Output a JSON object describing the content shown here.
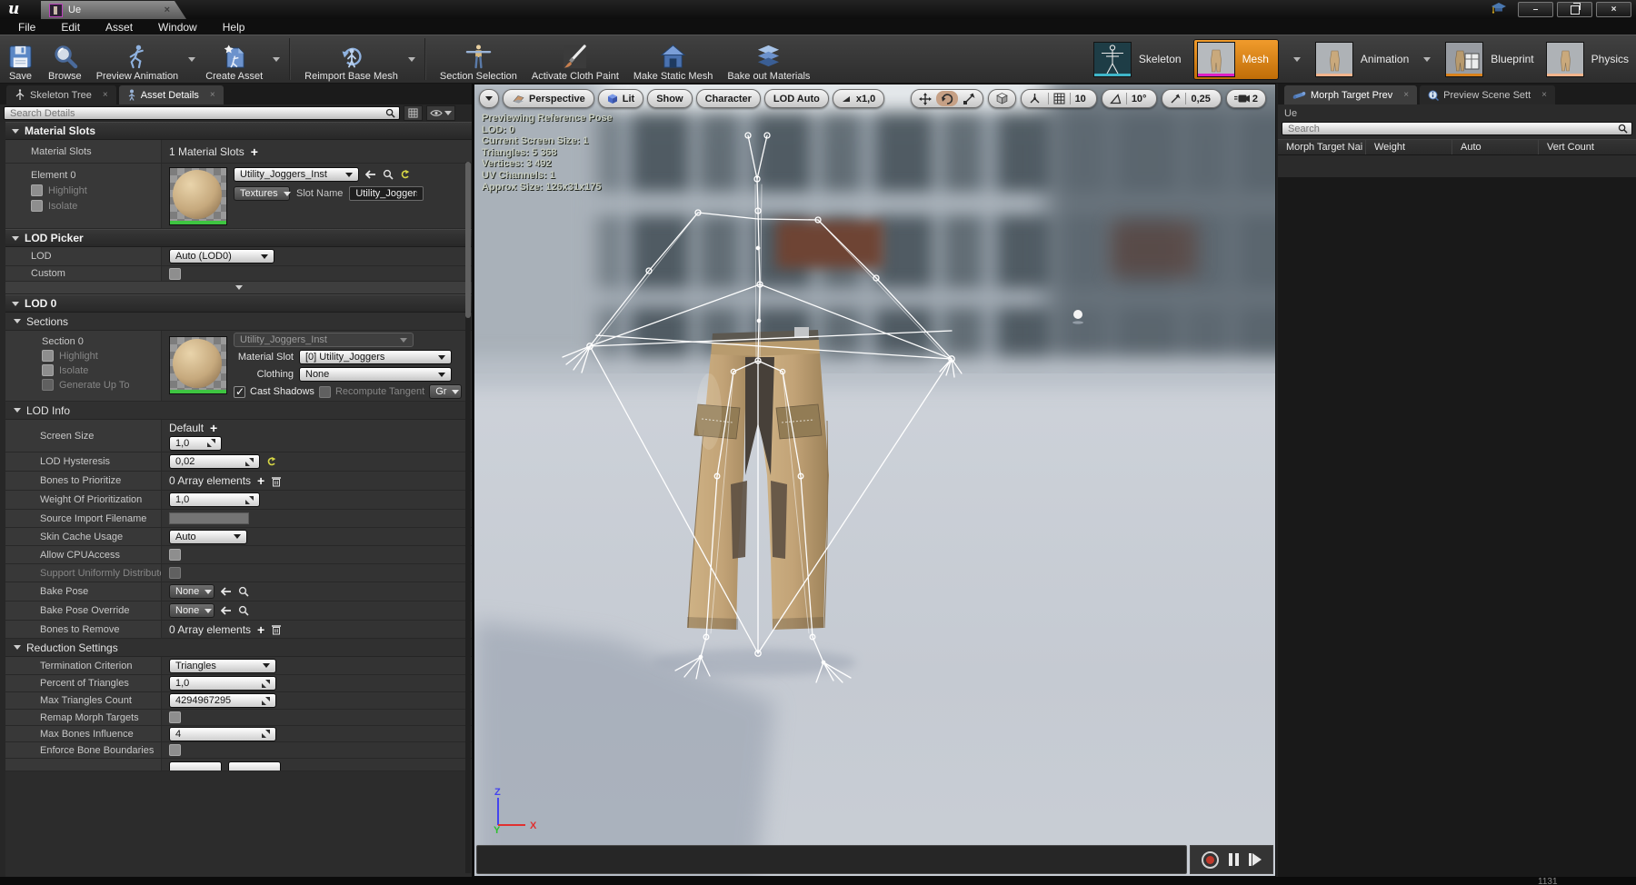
{
  "window": {
    "logo": "u",
    "tab": {
      "title": "Ue",
      "close": "×"
    },
    "menu": {
      "file": "File",
      "edit": "Edit",
      "asset": "Asset",
      "window": "Window",
      "help": "Help"
    },
    "controls": {
      "minimize": "–",
      "close": "×"
    }
  },
  "toolbar": {
    "save": "Save",
    "browse": "Browse",
    "preview_animation": "Preview Animation",
    "create_asset": "Create Asset",
    "reimport_base_mesh": "Reimport Base Mesh",
    "section_selection": "Section Selection",
    "activate_cloth_paint": "Activate Cloth Paint",
    "make_static_mesh": "Make Static Mesh",
    "bake_out_materials": "Bake out Materials"
  },
  "asset_tabs": {
    "skeleton": "Skeleton",
    "mesh": "Mesh",
    "animation": "Animation",
    "blueprint": "Blueprint",
    "physics": "Physics"
  },
  "colors": {
    "active_mode_orange": "#d9821c",
    "underline_skeleton": "#3fb6c9",
    "underline_mesh": "#df1fc5",
    "underline_animation": "#f2b48c",
    "underline_blueprint": "#d9821c",
    "underline_physics": "#f2b48c",
    "record_red": "#c0392b",
    "material_preview_green": "#3ec441"
  },
  "left_panel": {
    "tab_skeleton_tree": "Skeleton Tree",
    "tab_asset_details": "Asset Details",
    "search_placeholder": "Search Details",
    "material_slots": {
      "header": "Material Slots",
      "row_label": "Material Slots",
      "count": "1 Material Slots",
      "element": "Element 0",
      "highlight": "Highlight",
      "isolate": "Isolate",
      "instance": "Utility_Joggers_Inst",
      "textures": "Textures",
      "slot_name_label": "Slot Name",
      "slot_name": "Utility_Joggers"
    },
    "lod_picker": {
      "header": "LOD Picker",
      "lod": "LOD",
      "lod_value": "Auto (LOD0)",
      "custom": "Custom"
    },
    "lod0": {
      "header": "LOD 0",
      "sections": "Sections",
      "section": "Section 0",
      "highlight": "Highlight",
      "isolate": "Isolate",
      "generate_up_to": "Generate Up To",
      "instance": "Utility_Joggers_Inst",
      "material_slot": "Material Slot",
      "material_slot_value": "[0] Utility_Joggers",
      "clothing": "Clothing",
      "clothing_value": "None",
      "cast_shadows": "Cast Shadows",
      "recompute_tangent": "Recompute Tangent",
      "tangent_mode": "Gr"
    },
    "lod_info": {
      "header": "LOD Info",
      "default_label": "Default",
      "screen_size": "Screen Size",
      "screen_size_value": "1,0",
      "lod_hysteresis": "LOD Hysteresis",
      "lod_hysteresis_value": "0,02",
      "bones_to_prioritize": "Bones to Prioritize",
      "bones_to_prioritize_value": "0 Array elements",
      "weight_of_prioritization": "Weight Of Prioritization",
      "weight_of_prioritization_value": "1,0",
      "source_import_filename": "Source Import Filename",
      "skin_cache_usage": "Skin Cache Usage",
      "skin_cache_usage_value": "Auto",
      "allow_cpuaccess": "Allow CPUAccess",
      "support_uniformly": "Support Uniformly Distributed S",
      "bake_pose": "Bake Pose",
      "bake_pose_value": "None",
      "bake_pose_override": "Bake Pose Override",
      "bake_pose_override_value": "None",
      "bones_to_remove": "Bones to Remove",
      "bones_to_remove_value": "0 Array elements"
    },
    "reduction": {
      "header": "Reduction Settings",
      "termination_criterion": "Termination Criterion",
      "termination_criterion_value": "Triangles",
      "percent_of_triangles": "Percent of Triangles",
      "percent_of_triangles_value": "1,0",
      "max_triangles_count": "Max Triangles Count",
      "max_triangles_count_value": "4294967295",
      "remap_morph_targets": "Remap Morph Targets",
      "max_bones_influence": "Max Bones Influence",
      "max_bones_influence_value": "4",
      "enforce_bone_boundaries": "Enforce Bone Boundaries"
    }
  },
  "viewport": {
    "perspective": "Perspective",
    "lit": "Lit",
    "show": "Show",
    "character": "Character",
    "lod_auto": "LOD Auto",
    "speed": "x1,0",
    "grid_snap": "10",
    "angle_snap": "10°",
    "scale_snap": "0,25",
    "camera_speed": "2",
    "stats": [
      "Previewing Reference Pose",
      "LOD: 0",
      "Current Screen Size: 1",
      "Triangles: 5 368",
      "Vertices: 3 492",
      "UV Channels: 1",
      "Approx Size: 126x31x175"
    ],
    "axis_x": "X",
    "axis_y": "Y",
    "axis_z": "Z"
  },
  "right_panel": {
    "tab_morph": "Morph Target Prev",
    "tab_preview_scene": "Preview Scene Sett",
    "tab_close": "×",
    "breadcrumb": "Ue",
    "search_placeholder": "Search",
    "col_name": "Morph Target Nai",
    "col_weight": "Weight",
    "col_auto": "Auto",
    "col_vert": "Vert Count"
  },
  "statusbar": {
    "partial_text": "1131"
  }
}
